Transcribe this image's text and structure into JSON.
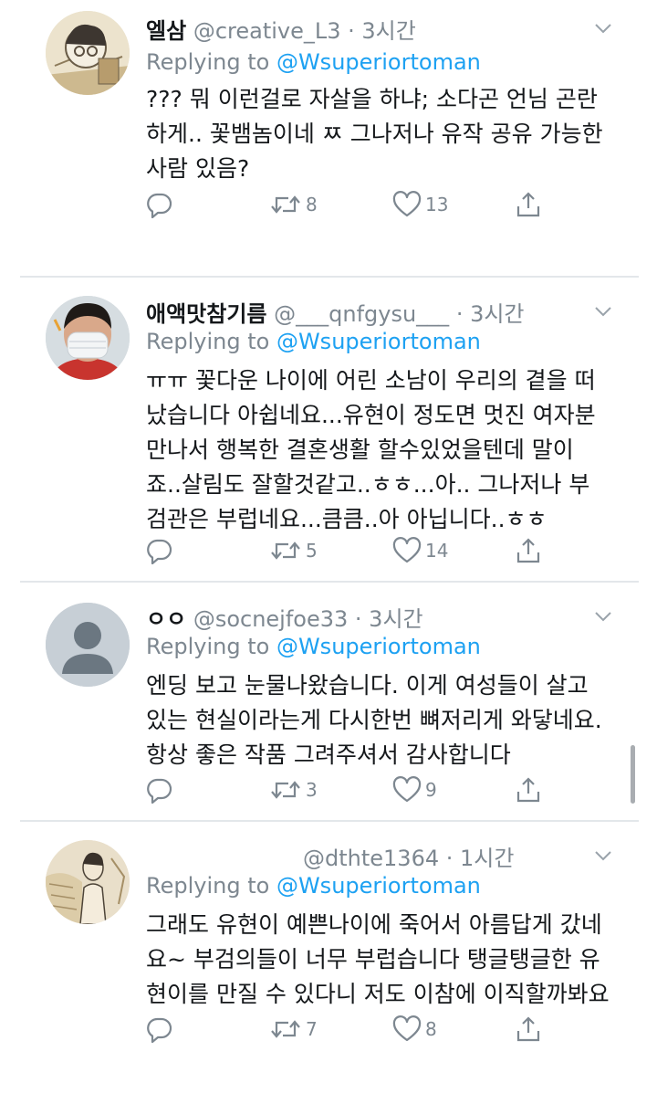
{
  "thread": {
    "tweets": [
      {
        "name": "엘삼",
        "handle": "@creative_L3",
        "time": "· 3시간",
        "replying_prefix": "Replying to",
        "replying_to": "@Wsuperiortoman",
        "lines": [
          "??? 뭐 이런걸로 자살을 하냐; 소다곤 언님 곤란",
          "하게.. 꽃뱀놈이네 ㅉ 그나저나 유작 공유 가능한",
          "사람 있음?"
        ],
        "retweets": "8",
        "likes": "13"
      },
      {
        "name": "애액맛참기름",
        "handle": "@___qnfgysu___",
        "time": "· 3시간",
        "replying_prefix": "Replying to",
        "replying_to": "@Wsuperiortoman",
        "lines": [
          "ㅠㅠ 꽃다운 나이에 어린 소남이 우리의 곁을 떠",
          "났습니다 아쉽네요...유현이 정도면 멋진 여자분",
          "만나서 행복한 결혼생활 할수있었을텐데 말이",
          "죠..살림도 잘할것같고..ㅎㅎ...아.. 그나저나 부",
          "검관은 부럽네요...큼큼..아 아닙니다..ㅎㅎ"
        ],
        "retweets": "5",
        "likes": "14"
      },
      {
        "name": "ㅇㅇ",
        "handle": "@socnejfoe33",
        "time": "· 3시간",
        "replying_prefix": "Replying to",
        "replying_to": "@Wsuperiortoman",
        "lines": [
          "엔딩 보고 눈물나왔습니다. 이게 여성들이 살고",
          "있는 현실이라는게 다시한번 뼈저리게 와닿네요.",
          "항상 좋은 작품 그려주셔서 감사합니다"
        ],
        "retweets": "3",
        "likes": "9"
      },
      {
        "name": "",
        "handle": "@dthte1364",
        "time": "· 1시간",
        "replying_prefix": "Replying to",
        "replying_to": "@Wsuperiortoman",
        "lines": [
          "그래도 유현이 예쁜나이에 죽어서 아름답게 갔네",
          "요~ 부검의들이 너무 부럽습니다 탱글탱글한 유",
          "현이를 만질 수 있다니 저도 이참에 이직할까봐요"
        ],
        "retweets": "7",
        "likes": "8"
      }
    ]
  },
  "colors": {
    "text": "#14171a",
    "muted": "#7d8790",
    "accent": "#1da1f2",
    "divider": "#e3e7ea"
  },
  "icons": [
    "reply-icon",
    "retweet-icon",
    "like-icon",
    "share-icon",
    "chevron-down-icon"
  ]
}
